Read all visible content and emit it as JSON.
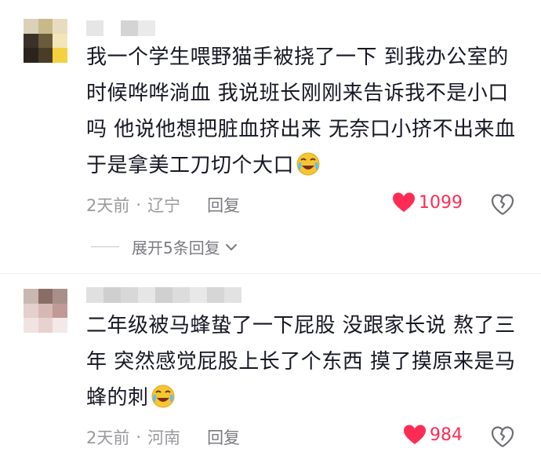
{
  "comments": [
    {
      "text": "我一个学生喂野猫手被挠了一下 到我办公室的时候哗哗淌血 我说班长刚刚来告诉我不是小口吗 他说他想把脏血挤出来 无奈口小挤不出来血于是拿美工刀切个大口",
      "emoji": "laughing-crying-emoji",
      "time": "2天前",
      "separator": "·",
      "location": "辽宁",
      "reply_label": "回复",
      "likes": "1099",
      "avatar_colors": [
        "#d9d2b8",
        "#c8b98a",
        "#e8dcc0",
        "#3a3228",
        "#6b5a3c",
        "#f2e6b8",
        "#2a241c",
        "#4a3d28",
        "#f5d040"
      ],
      "username_colors": [
        "#e6e6e6",
        "#ffffff",
        "#d4d4d4",
        "#eaeaea"
      ]
    },
    {
      "text": "二年级被马蜂蛰了一下屁股 没跟家长说 熬了三年 突然感觉屁股上长了个东西 摸了摸原来是马蜂的刺",
      "emoji": "laughing-crying-emoji",
      "time": "2天前",
      "separator": "·",
      "location": "河南",
      "reply_label": "回复",
      "likes": "984",
      "avatar_colors": [
        "#c9b8b0",
        "#8a6e66",
        "#a89088",
        "#e4d0cc",
        "#d8b8b4",
        "#c09a96",
        "#f0e4e2",
        "#e8d2d0",
        "#f4e8e8"
      ],
      "username_colors": [
        "#e0e0e0",
        "#cfcfcf",
        "#d8d8d8",
        "#e6e6e6",
        "#d0d0d0",
        "#dcdcdc",
        "#e8e8e8",
        "#d6d6d6",
        "#e2e2e2"
      ]
    }
  ],
  "expand_label": "展开5条回复",
  "colors": {
    "like": "#fe2c55",
    "meta": "#9a9a9e",
    "text": "#161823"
  }
}
